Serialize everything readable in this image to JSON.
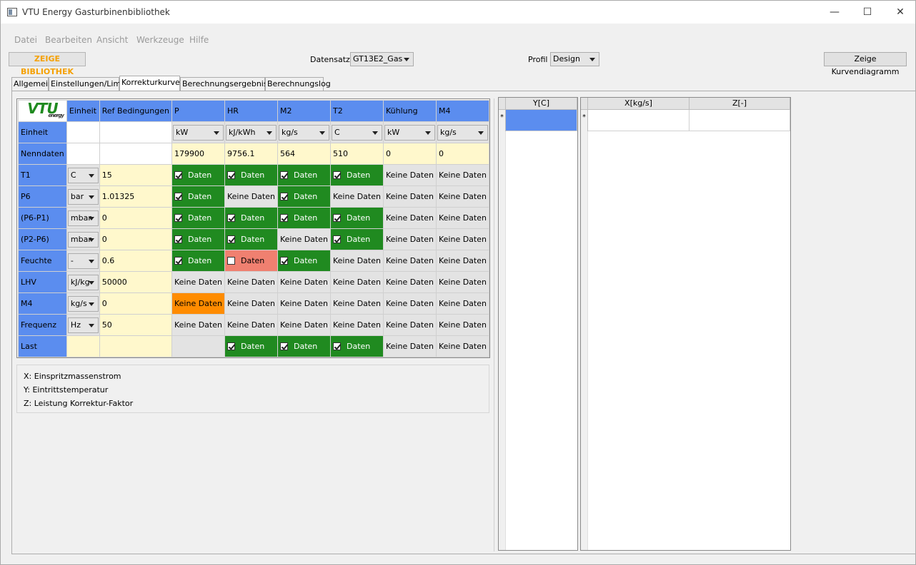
{
  "window": {
    "title": "VTU Energy Gasturbinenbibliothek",
    "minimize": "—",
    "maximize": "☐",
    "close": "✕"
  },
  "menu": [
    "Datei",
    "Bearbeiten",
    "Ansicht",
    "Werkzeuge",
    "Hilfe"
  ],
  "toolbar": {
    "library_button": "ZEIGE BIBLIOTHEK",
    "dataset_label": "Datensatz",
    "dataset_value": "GT13E2_Gas",
    "profile_label": "Profil",
    "profile_value": "Design",
    "curve_button": "Zeige Kurvendiagramm"
  },
  "tabs": [
    "Allgemein",
    "Einstellungen/Limits",
    "Korrekturkurven",
    "Berechnungsergebnisse",
    "Berechnungslog"
  ],
  "active_tab": "Korrekturkurven",
  "grid": {
    "logo_text": "VTU",
    "logo_sub": "energy",
    "headers": [
      "Einheit",
      "Ref Bedingungen",
      "P",
      "HR",
      "M2",
      "T2",
      "Kühlung",
      "M4"
    ],
    "unit_row": {
      "label": "Einheit",
      "units": [
        "kW",
        "kJ/kWh",
        "kg/s",
        "C",
        "kW",
        "kg/s"
      ]
    },
    "nominal_row": {
      "label": "Nenndaten",
      "values": [
        "179900",
        "9756.1",
        "564",
        "510",
        "0",
        "0"
      ]
    },
    "rows": [
      {
        "label": "T1",
        "unit": "C",
        "ref": "15",
        "cells": [
          [
            "green",
            "Daten",
            true
          ],
          [
            "green",
            "Daten",
            true
          ],
          [
            "green",
            "Daten",
            true
          ],
          [
            "green",
            "Daten",
            true
          ],
          [
            "gray",
            "Keine Daten",
            null
          ],
          [
            "gray",
            "Keine Daten",
            null
          ]
        ]
      },
      {
        "label": "P6",
        "unit": "bar",
        "ref": "1.01325",
        "cells": [
          [
            "green",
            "Daten",
            true
          ],
          [
            "gray",
            "Keine Daten",
            null
          ],
          [
            "green",
            "Daten",
            true
          ],
          [
            "gray",
            "Keine Daten",
            null
          ],
          [
            "gray",
            "Keine Daten",
            null
          ],
          [
            "gray",
            "Keine Daten",
            null
          ]
        ]
      },
      {
        "label": "(P6-P1)",
        "unit": "mbar",
        "ref": "0",
        "cells": [
          [
            "green",
            "Daten",
            true
          ],
          [
            "green",
            "Daten",
            true
          ],
          [
            "green",
            "Daten",
            true
          ],
          [
            "green",
            "Daten",
            true
          ],
          [
            "gray",
            "Keine Daten",
            null
          ],
          [
            "gray",
            "Keine Daten",
            null
          ]
        ]
      },
      {
        "label": "(P2-P6)",
        "unit": "mbar",
        "ref": "0",
        "cells": [
          [
            "green",
            "Daten",
            true
          ],
          [
            "green",
            "Daten",
            true
          ],
          [
            "gray",
            "Keine Daten",
            null
          ],
          [
            "green",
            "Daten",
            true
          ],
          [
            "gray",
            "Keine Daten",
            null
          ],
          [
            "gray",
            "Keine Daten",
            null
          ]
        ]
      },
      {
        "label": "Feuchte",
        "unit": "-",
        "ref": "0.6",
        "cells": [
          [
            "green",
            "Daten",
            true
          ],
          [
            "red",
            "Daten",
            false
          ],
          [
            "green",
            "Daten",
            true
          ],
          [
            "gray",
            "Keine Daten",
            null
          ],
          [
            "gray",
            "Keine Daten",
            null
          ],
          [
            "gray",
            "Keine Daten",
            null
          ]
        ]
      },
      {
        "label": "LHV",
        "unit": "kJ/kg",
        "ref": "50000",
        "cells": [
          [
            "gray",
            "Keine Daten",
            null
          ],
          [
            "gray",
            "Keine Daten",
            null
          ],
          [
            "gray",
            "Keine Daten",
            null
          ],
          [
            "gray",
            "Keine Daten",
            null
          ],
          [
            "gray",
            "Keine Daten",
            null
          ],
          [
            "gray",
            "Keine Daten",
            null
          ]
        ]
      },
      {
        "label": "M4",
        "unit": "kg/s",
        "ref": "0",
        "cells": [
          [
            "orange",
            "Keine Daten",
            null
          ],
          [
            "gray",
            "Keine Daten",
            null
          ],
          [
            "gray",
            "Keine Daten",
            null
          ],
          [
            "gray",
            "Keine Daten",
            null
          ],
          [
            "gray",
            "Keine Daten",
            null
          ],
          [
            "gray",
            "Keine Daten",
            null
          ]
        ]
      },
      {
        "label": "Frequenz",
        "unit": "Hz",
        "ref": "50",
        "cells": [
          [
            "gray",
            "Keine Daten",
            null
          ],
          [
            "gray",
            "Keine Daten",
            null
          ],
          [
            "gray",
            "Keine Daten",
            null
          ],
          [
            "gray",
            "Keine Daten",
            null
          ],
          [
            "gray",
            "Keine Daten",
            null
          ],
          [
            "gray",
            "Keine Daten",
            null
          ]
        ]
      },
      {
        "label": "Last",
        "unit": "",
        "ref": "",
        "cells": [
          [
            "gray",
            "",
            null
          ],
          [
            "green",
            "Daten",
            true
          ],
          [
            "green",
            "Daten",
            true
          ],
          [
            "green",
            "Daten",
            true
          ],
          [
            "gray",
            "Keine Daten",
            null
          ],
          [
            "gray",
            "Keine Daten",
            null
          ]
        ]
      }
    ]
  },
  "legend": [
    "X:  Einspritzmassenstrom",
    "Y:  Eintrittstemperatur",
    "Z:  Leistung Korrektur-Faktor"
  ],
  "y_table": {
    "header": "Y[C]",
    "new_row_marker": "*"
  },
  "xz_table": {
    "headers": [
      "X[kg/s]",
      "Z[-]"
    ],
    "new_row_marker": "*"
  },
  "colors": {
    "header_blue": "#5b8def",
    "cream": "#fff8cc",
    "green": "#208a20",
    "red": "#f08070",
    "orange": "#ff8c00",
    "gray": "#e3e3e3",
    "library_orange": "#f5a000"
  }
}
